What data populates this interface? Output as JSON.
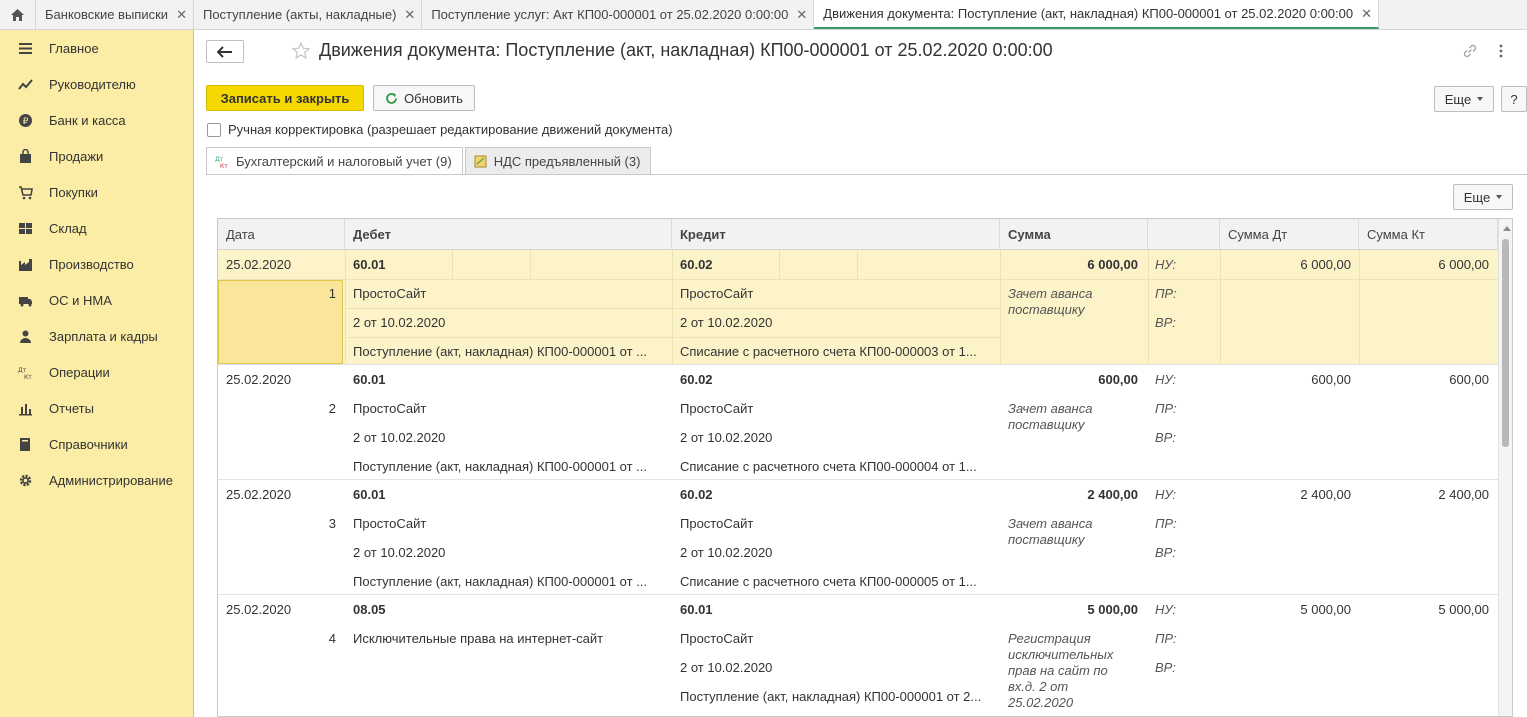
{
  "top_tabs": [
    {
      "label": "Банковские выписки"
    },
    {
      "label": "Поступление (акты, накладные)"
    },
    {
      "label": "Поступление услуг: Акт КП00-000001 от 25.02.2020 0:00:00"
    },
    {
      "label": "Движения документа: Поступление (акт, накладная) КП00-000001 от 25.02.2020 0:00:00"
    }
  ],
  "sidebar": {
    "items": [
      {
        "label": "Главное",
        "icon": "menu-icon"
      },
      {
        "label": "Руководителю",
        "icon": "trend-icon"
      },
      {
        "label": "Банк и касса",
        "icon": "coin-icon"
      },
      {
        "label": "Продажи",
        "icon": "bag-icon"
      },
      {
        "label": "Покупки",
        "icon": "cart-icon"
      },
      {
        "label": "Склад",
        "icon": "grid-icon"
      },
      {
        "label": "Производство",
        "icon": "factory-icon"
      },
      {
        "label": "ОС и НМА",
        "icon": "truck-icon"
      },
      {
        "label": "Зарплата и кадры",
        "icon": "person-icon"
      },
      {
        "label": "Операции",
        "icon": "dt-kt-icon"
      },
      {
        "label": "Отчеты",
        "icon": "bar-chart-icon"
      },
      {
        "label": "Справочники",
        "icon": "book-icon"
      },
      {
        "label": "Администрирование",
        "icon": "gear-icon"
      }
    ]
  },
  "header": {
    "title": "Движения документа: Поступление (акт, накладная) КП00-000001 от 25.02.2020 0:00:00"
  },
  "toolbar": {
    "save_close": "Записать и закрыть",
    "refresh": "Обновить",
    "more": "Еще",
    "help": "?"
  },
  "manual_correction": {
    "label": "Ручная корректировка (разрешает редактирование движений документа)",
    "checked": false
  },
  "subtabs": [
    {
      "label": "Бухгалтерский и налоговый учет (9)",
      "icon_text": "Дт Кт"
    },
    {
      "label": "НДС предъявленный (3)"
    }
  ],
  "table_toolbar": {
    "more": "Еще"
  },
  "table": {
    "columns": [
      "Дата",
      "Дебет",
      "Кредит",
      "Сумма",
      "",
      "Сумма Дт",
      "Сумма Кт"
    ],
    "row_labels": {
      "nu": "НУ:",
      "pr": "ПР:",
      "vr": "ВР:"
    },
    "rows": [
      {
        "date": "25.02.2020",
        "num": "1",
        "debit": "60.01",
        "debit_sub1": "ПростоСайт",
        "debit_sub2": "2 от 10.02.2020",
        "debit_sub3": "Поступление (акт, накладная) КП00-000001 от ...",
        "credit": "60.02",
        "credit_sub1": "ПростоСайт",
        "credit_sub2": "2 от 10.02.2020",
        "credit_sub3": "Списание с расчетного счета КП00-000003 от 1...",
        "sum": "6 000,00",
        "content": [
          "Зачет аванса",
          "поставщику"
        ],
        "sum_dt": "6 000,00",
        "sum_kt": "6 000,00"
      },
      {
        "date": "25.02.2020",
        "num": "2",
        "debit": "60.01",
        "debit_sub1": "ПростоСайт",
        "debit_sub2": "2 от 10.02.2020",
        "debit_sub3": "Поступление (акт, накладная) КП00-000001 от ...",
        "credit": "60.02",
        "credit_sub1": "ПростоСайт",
        "credit_sub2": "2 от 10.02.2020",
        "credit_sub3": "Списание с расчетного счета КП00-000004 от 1...",
        "sum": "600,00",
        "content": [
          "Зачет аванса",
          "поставщику"
        ],
        "sum_dt": "600,00",
        "sum_kt": "600,00"
      },
      {
        "date": "25.02.2020",
        "num": "3",
        "debit": "60.01",
        "debit_sub1": "ПростоСайт",
        "debit_sub2": "2 от 10.02.2020",
        "debit_sub3": "Поступление (акт, накладная) КП00-000001 от ...",
        "credit": "60.02",
        "credit_sub1": "ПростоСайт",
        "credit_sub2": "2 от 10.02.2020",
        "credit_sub3": "Списание с расчетного счета КП00-000005 от 1...",
        "sum": "2 400,00",
        "content": [
          "Зачет аванса",
          "поставщику"
        ],
        "sum_dt": "2 400,00",
        "sum_kt": "2 400,00"
      },
      {
        "date": "25.02.2020",
        "num": "4",
        "debit": "08.05",
        "debit_sub1": "Исключительные права на интернет-сайт",
        "debit_sub2": "",
        "debit_sub3": "",
        "credit": "60.01",
        "credit_sub1": "ПростоСайт",
        "credit_sub2": "2 от 10.02.2020",
        "credit_sub3": "Поступление (акт, накладная) КП00-000001 от 2...",
        "sum": "5 000,00",
        "content": [
          "Регистрация",
          "исключительных",
          "прав на сайт по",
          "вх.д. 2 от",
          "25.02.2020"
        ],
        "sum_dt": "5 000,00",
        "sum_kt": "5 000,00"
      }
    ]
  }
}
